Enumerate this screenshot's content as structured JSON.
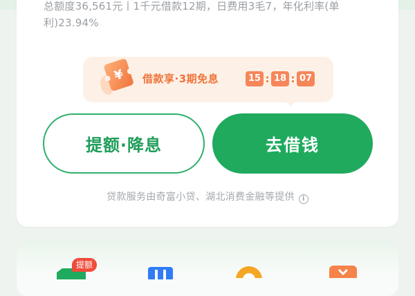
{
  "loan_offer": {
    "quota_description": "总额度36,561元丨1千元借款12期，日费用3毛7，年化利率(单利)23.94%"
  },
  "promo": {
    "text": "借款享·3期免息",
    "countdown": {
      "hours": "15",
      "minutes": "18",
      "seconds": "07",
      "separator": ":"
    },
    "ticket_symbol": "¥"
  },
  "actions": {
    "raise_limit_label": "提额·降息",
    "borrow_label": "去借钱"
  },
  "provider_note": "贷款服务由奇富小贷、湖北消费金融等提供",
  "info_symbol": "i",
  "services": {
    "badge": "提额",
    "items": [
      {
        "icon": "green-tag-icon",
        "color": "#1faa5e"
      },
      {
        "icon": "blue-h-icon",
        "color": "#2f7cf6"
      },
      {
        "icon": "orange-circle-icon",
        "color": "#f5a623"
      },
      {
        "icon": "orange-yen-icon",
        "color": "#f5834a"
      }
    ]
  },
  "colors": {
    "brand_green": "#1faa5e",
    "promo_orange": "#f0743a",
    "muted_text": "#9a9ea3",
    "badge_red": "#f04b3a"
  }
}
